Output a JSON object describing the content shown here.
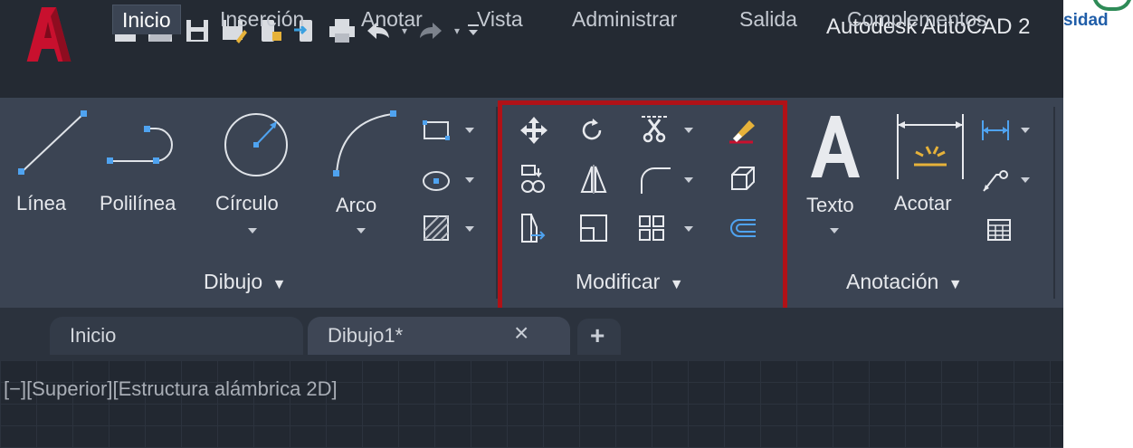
{
  "app": {
    "title": "Autodesk AutoCAD 2",
    "brand_color": "#c8102e",
    "overlay_text": "sidad"
  },
  "tabs": [
    "Inicio",
    "Inserción",
    "Anotar",
    "Vista",
    "Administrar",
    "Salida",
    "Complementos"
  ],
  "ribbon": {
    "draw": {
      "linea": "Línea",
      "polilinea": "Polilínea",
      "circulo": "Círculo",
      "arco": "Arco",
      "panel": "Dibujo"
    },
    "modify": {
      "panel": "Modificar"
    },
    "annotation": {
      "texto": "Texto",
      "acotar": "Acotar",
      "panel": "Anotación"
    }
  },
  "doc_tabs": {
    "tab1": "Inicio",
    "tab2": "Dibujo1*",
    "close": "×",
    "add": "+"
  },
  "viewport": {
    "label": "[−][Superior][Estructura alámbrica 2D]"
  },
  "highlight": {
    "color": "#b01217"
  }
}
